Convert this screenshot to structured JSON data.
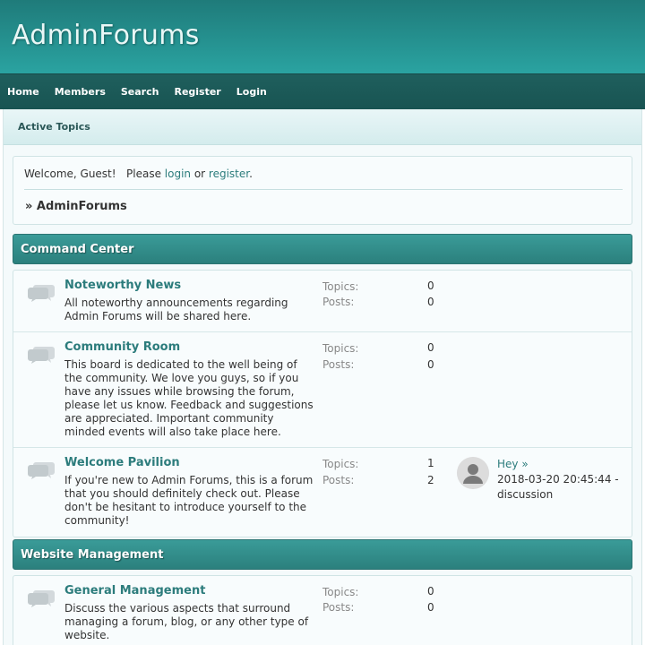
{
  "site": {
    "title": "AdminForums"
  },
  "nav": {
    "items": [
      "Home",
      "Members",
      "Search",
      "Register",
      "Login"
    ]
  },
  "subnav": {
    "active_topics": "Active Topics"
  },
  "welcome": {
    "prefix": "Welcome, Guest!   Please ",
    "login": "login",
    "or": " or ",
    "register": "register",
    "suffix": ".",
    "breadcrumb": "» AdminForums"
  },
  "categories": [
    {
      "title": "Command Center",
      "boards": [
        {
          "name": "Noteworthy News",
          "description": "All noteworthy announcements regarding Admin Forums will be shared here.",
          "topics_label": "Topics:",
          "topics": "0",
          "posts_label": "Posts:",
          "posts": "0"
        },
        {
          "name": "Community Room",
          "description": "This board is dedicated to the well being of the community. We love you guys, so if you have any issues while browsing the forum, please let us know. Feedback and suggestions are appreciated. Important community minded events will also take place here.",
          "topics_label": "Topics:",
          "topics": "0",
          "posts_label": "Posts:",
          "posts": "0"
        },
        {
          "name": "Welcome Pavilion",
          "description": "If you're new to Admin Forums, this is a forum that you should definitely check out. Please don't be hesitant to introduce yourself to the community!",
          "topics_label": "Topics:",
          "topics": "1",
          "posts_label": "Posts:",
          "posts": "2",
          "last_post": {
            "title": "Hey",
            "arrow": "»",
            "date": "2018-03-20 20:45:44 -",
            "board": "discussion"
          }
        }
      ]
    },
    {
      "title": "Website Management",
      "boards": [
        {
          "name": "General Management",
          "description": "Discuss the various aspects that surround managing a forum, blog, or any other type of website.",
          "topics_label": "Topics:",
          "topics": "0",
          "posts_label": "Posts:",
          "posts": "0"
        }
      ]
    }
  ],
  "icons": {
    "board": "speech-bubbles-icon",
    "avatar": "user-avatar-icon"
  },
  "colors": {
    "header": "#2aa3a1",
    "navbar": "#1f5f5d",
    "link": "#2c7c7c",
    "category": "#2f8b88"
  }
}
